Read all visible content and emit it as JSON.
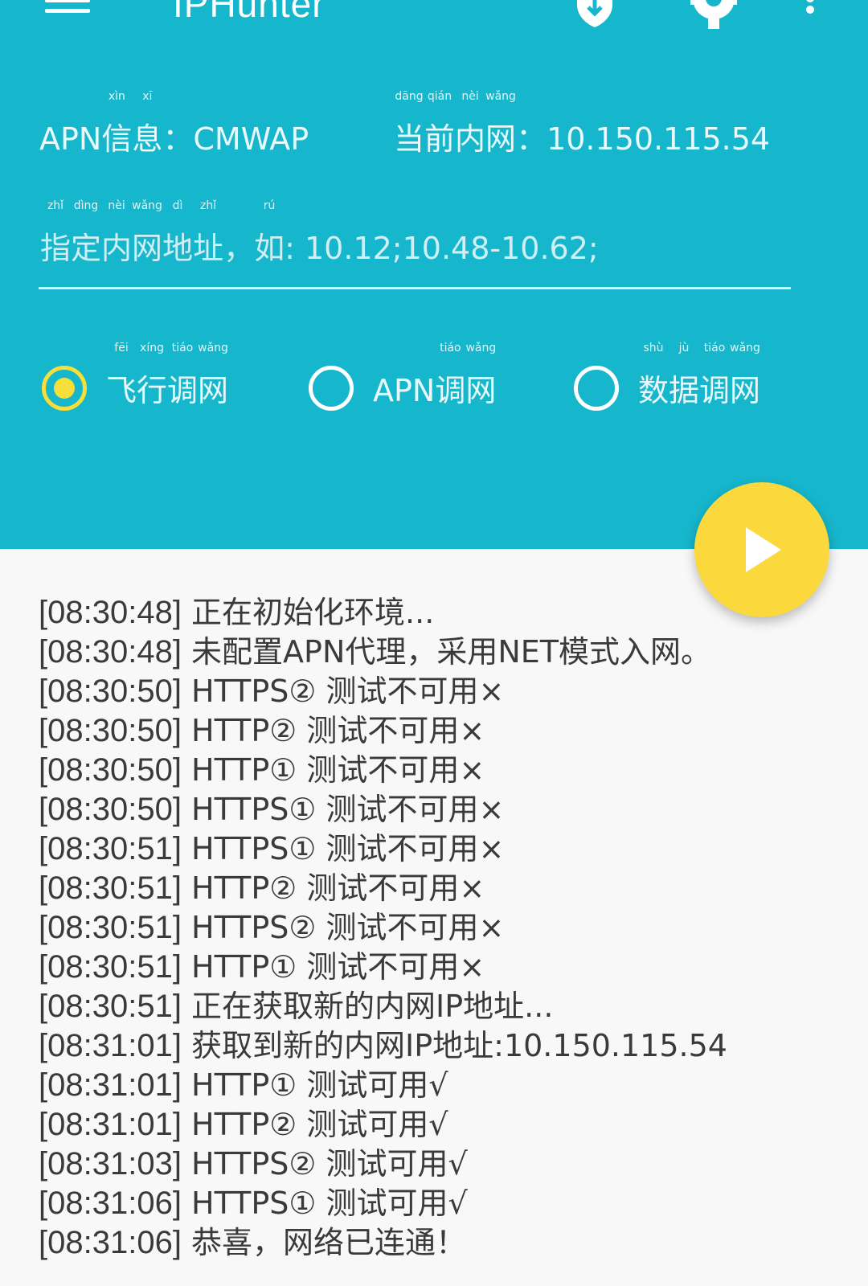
{
  "app": {
    "title": "IPHunter",
    "icons": {
      "menu": "menu-icon",
      "shield": "shield-icon",
      "settings": "gear-icon",
      "more": "more-vert-icon"
    }
  },
  "colors": {
    "primary": "#16b6cc",
    "accent": "#fbd93c",
    "background": "#f8f8f8"
  },
  "info": {
    "apn_label": "APN信息：",
    "apn_value": "CMWAP",
    "current_net_label": "当前内网：",
    "current_net_value": "10.150.115.54"
  },
  "address_input": {
    "placeholder": "指定内网地址，如: 10.12;10.48-10.62;",
    "value": ""
  },
  "modes": [
    {
      "label": "飞行调网",
      "selected": true
    },
    {
      "label": "APN调网",
      "selected": false
    },
    {
      "label": "数据调网",
      "selected": false
    }
  ],
  "fab": {
    "icon": "play-icon"
  },
  "log": [
    {
      "time": "[08:30:48]",
      "msg": "正在初始化环境..."
    },
    {
      "time": "[08:30:48]",
      "msg": "未配置APN代理，采用NET模式入网。"
    },
    {
      "time": "[08:30:50]",
      "msg": "HTTPS② 测试不可用×"
    },
    {
      "time": "[08:30:50]",
      "msg": "HTTP②  测试不可用×"
    },
    {
      "time": "[08:30:50]",
      "msg": "HTTP①  测试不可用×"
    },
    {
      "time": "[08:30:50]",
      "msg": "HTTPS① 测试不可用×"
    },
    {
      "time": "[08:30:51]",
      "msg": "HTTPS① 测试不可用×"
    },
    {
      "time": "[08:30:51]",
      "msg": "HTTP②  测试不可用×"
    },
    {
      "time": "[08:30:51]",
      "msg": "HTTPS② 测试不可用×"
    },
    {
      "time": "[08:30:51]",
      "msg": "HTTP①  测试不可用×"
    },
    {
      "time": "[08:30:51]",
      "msg": "正在获取新的内网IP地址..."
    },
    {
      "time": "[08:31:01]",
      "msg": "获取到新的内网IP地址:10.150.115.54"
    },
    {
      "time": "[08:31:01]",
      "msg": "HTTP①  测试可用√"
    },
    {
      "time": "[08:31:01]",
      "msg": "HTTP②  测试可用√"
    },
    {
      "time": "[08:31:03]",
      "msg": "HTTPS② 测试可用√"
    },
    {
      "time": "[08:31:06]",
      "msg": "HTTPS① 测试可用√"
    },
    {
      "time": "[08:31:06]",
      "msg": "恭喜，网络已连通！"
    }
  ]
}
